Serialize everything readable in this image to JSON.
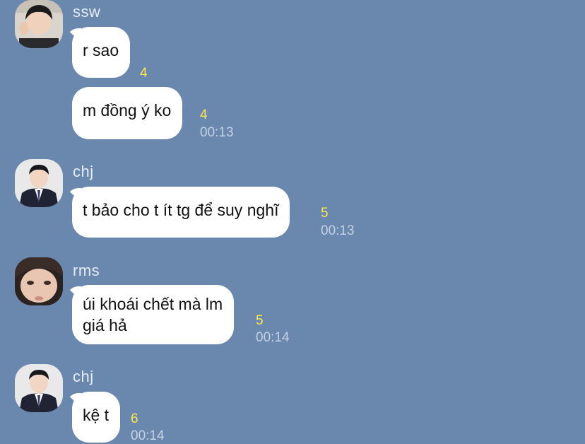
{
  "messages": [
    {
      "sender": "ssw",
      "bubbles": [
        {
          "text": "r sao",
          "unread": "4"
        },
        {
          "text": "m đồng ý ko",
          "unread": "4",
          "time": "00:13"
        }
      ]
    },
    {
      "sender": "chj",
      "bubbles": [
        {
          "text": "t bảo cho t ít tg để suy nghĩ",
          "unread": "5",
          "time": "00:13"
        }
      ]
    },
    {
      "sender": "rms",
      "bubbles": [
        {
          "text": "úi khoái chết mà lm\ngiá hả",
          "unread": "5",
          "time": "00:14"
        }
      ]
    },
    {
      "sender": "chj",
      "bubbles": [
        {
          "text": "kệ t",
          "unread": "6",
          "time": "00:14"
        }
      ]
    }
  ],
  "colors": {
    "background": "#6a87ad",
    "bubble": "#ffffff",
    "unread": "#ffe74a",
    "time": "#c4d2e4"
  }
}
